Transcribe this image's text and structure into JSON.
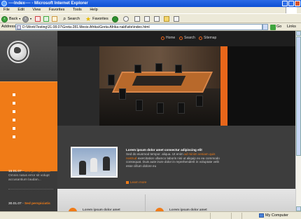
{
  "window": {
    "title": "----Index---- - Microsoft Internet Explorer"
  },
  "menu": [
    "File",
    "Edit",
    "View",
    "Favorites",
    "Tools",
    "Help"
  ],
  "toolbar": {
    "back_label": "Back",
    "search_label": "Search",
    "favorites_label": "Favorites"
  },
  "address": {
    "label": "Address",
    "url": "D:\\Work\\Testing\\31.08.07\\Greta-281.Mexis-Afrika\\Greta-Afrika-nald\\site\\index.html",
    "go_label": "Go",
    "links_label": "Links"
  },
  "site": {
    "topnav": [
      "Home",
      "Search",
      "Sitemap"
    ],
    "nav_items": [
      "",
      "",
      "",
      "",
      "",
      ""
    ],
    "news": [
      {
        "date": "15.01.07",
        "head": "Sed perspiciatis",
        "body": "Omnis natus error sit volupt accusantium laudan..."
      },
      {
        "date": "30.01.07",
        "head": "Sed perspiciatis",
        "body": ""
      }
    ],
    "feature": {
      "title": "Lorem ipsum dolor amet consectur adipiscing elit",
      "text_a": "Sed do eiusmod tempor. aliqua. Ut enim",
      "text_highlight": "ad minim veniam quis nostrud",
      "text_b": "exercitation ullamco laboris nisi ut aliquip ex ea commodo consequat. Duis aute irure dolor in reprehenderit in voluptate velit esse cillum dolore eu",
      "more": "Learn more"
    },
    "bottom": [
      "Lorem ipsum dolor amet",
      "Lorem ipsum dolor amet"
    ]
  },
  "status": {
    "zone": "My Computer"
  }
}
